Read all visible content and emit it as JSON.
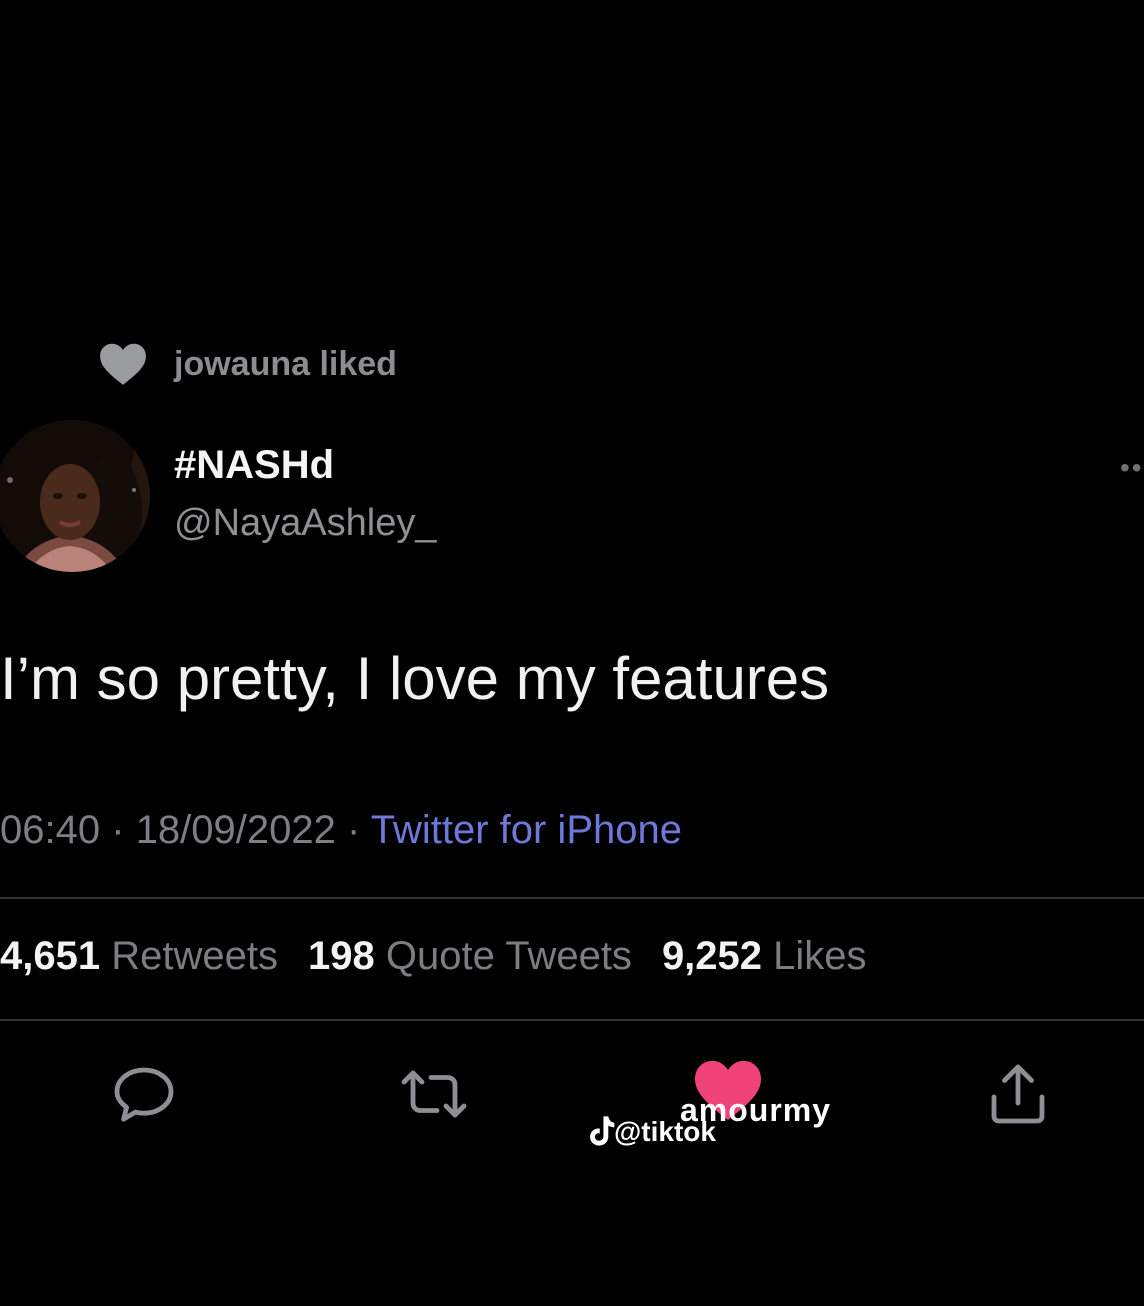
{
  "activity": {
    "liked_text": "jowauna liked"
  },
  "tweet": {
    "display_name": "#NASHd",
    "handle": "@NayaAshley_",
    "text": "I’m so pretty, I love my features",
    "time": "06:40",
    "separator": "·",
    "date": "18/09/2022",
    "source": "Twitter for iPhone"
  },
  "stats": {
    "retweets_count": "4,651",
    "retweets_label": "Retweets",
    "quotes_count": "198",
    "quotes_label": "Quote Tweets",
    "likes_count": "9,252",
    "likes_label": "Likes"
  },
  "actions": {
    "reply_icon": "reply-bubble-icon",
    "retweet_icon": "retweet-arrows-icon",
    "like_icon": "heart-filled-icon",
    "share_icon": "share-upload-icon"
  },
  "watermark": {
    "line1": "amourmy",
    "line2": "@tiktok"
  },
  "colors": {
    "background": "#000000",
    "like_heart": "#f0437c",
    "source_link": "#6f78d8",
    "muted_text": "#7c7f83",
    "divider": "#2f3336"
  }
}
